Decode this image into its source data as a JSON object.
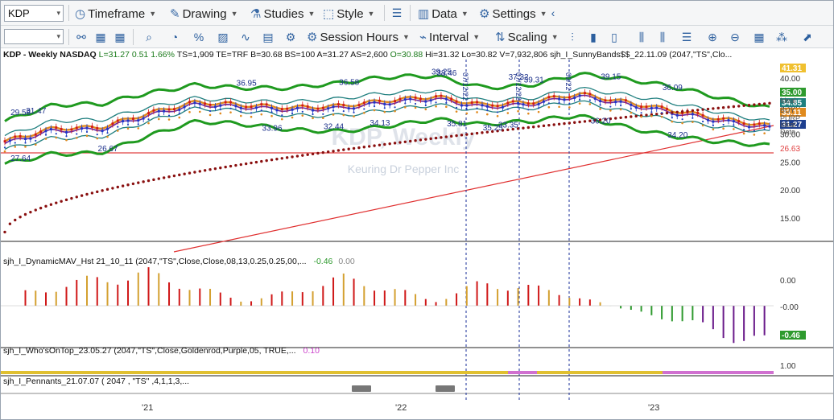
{
  "toolbar1": {
    "symbol": "KDP",
    "timeframe": "Timeframe",
    "drawing": "Drawing",
    "studies": "Studies",
    "style": "Style",
    "data": "Data",
    "settings": "Settings"
  },
  "toolbar2": {
    "session_hours": "Session Hours",
    "interval": "Interval",
    "scaling": "Scaling"
  },
  "header": {
    "title": "KDP - Weekly  NASDAQ",
    "L": "L=31.27",
    "chg": "0.51",
    "pct": "1.66%",
    "TS": "TS=1,909",
    "TE": "TE=TRF",
    "B": "B=30.68",
    "BS": "BS=100",
    "A": "A=31.27",
    "AS": "AS=2,600",
    "O": "O=30.88",
    "Hi": "Hi=31.32",
    "Lo": "Lo=30.82",
    "V": "V=7,932,806",
    "study": "sjh_I_SunnyBands$$_22.11.09 (2047,\"TS\",Clo..."
  },
  "watermark": {
    "line1": "KDP, Weekly",
    "line2": "Keuring Dr Pepper Inc"
  },
  "price_annotations": [
    "36.95",
    "36.58",
    "37.32",
    "39.25",
    "38.46",
    "39.31",
    "39.15",
    "36.09",
    "29.58",
    "31.47",
    "27.64",
    "26.67",
    "33.96",
    "32.44",
    "34.13",
    "35.81",
    "33.35",
    "36.20",
    "34.20",
    "35.25",
    "26.63"
  ],
  "right_axis": {
    "ticks": [
      "40.00",
      "35.00",
      "30.00",
      "25.00",
      "20.00",
      "15.00"
    ],
    "pills": [
      {
        "text": "41.31",
        "color": "#f0c030"
      },
      {
        "text": "35.00",
        "color": "#2e9a2e"
      },
      {
        "text": "34.85",
        "color": "#1f7f7f"
      },
      {
        "text": "33.11",
        "color": "#e08a1e"
      },
      {
        "text": "31.27",
        "color": "#1e3f8f"
      }
    ],
    "legend_labels": [
      "Ideal",
      "BUY",
      "PURP",
      "Ideal",
      "Date"
    ],
    "hline_label": "26.63"
  },
  "panel1": {
    "title": "sjh_I_DynamicMAV_Hst 21_10_11 (2047,\"TS\",Close,Close,08,13,0.25,0.25,00,...",
    "v1": "-0.46",
    "v2": "0.00",
    "ticks": [
      "0.00",
      "-0.00"
    ],
    "pill": "-0.46"
  },
  "panel2": {
    "title": "sjh_I_Who'sOnTop_23.05.27 (2047,\"TS\",Close,Goldenrod,Purple,05,  TRUE,...",
    "v1": "0.10"
  },
  "panel3": {
    "title": "sjh_I_Pennants_21.07.07 ( 2047 , \"TS\" ,4,1,1,3,...",
    "tick": "1.00"
  },
  "x_axis": {
    "labels": [
      "'21",
      "'22",
      "'23"
    ]
  },
  "vlines": [
    "07/12/22",
    "07/12/22",
    "09/22"
  ],
  "chart_data": {
    "type": "line",
    "title": "KDP - Weekly  NASDAQ",
    "x": [
      "2020-10",
      "2020-12",
      "2021-02",
      "2021-04",
      "2021-06",
      "2021-08",
      "2021-10",
      "2021-12",
      "2022-02",
      "2022-04",
      "2022-06",
      "2022-08",
      "2022-10",
      "2022-12",
      "2023-02",
      "2023-04",
      "2023-06"
    ],
    "series": [
      {
        "values": [
          28.5,
          30.8,
          31.0,
          33.5,
          35.5,
          35.0,
          34.5,
          34.8,
          35.8,
          36.5,
          35.0,
          35.5,
          37.0,
          35.5,
          34.0,
          32.5,
          31.27
        ]
      }
    ],
    "ylim": [
      10,
      42
    ],
    "hlines": [
      26.63
    ],
    "histogram": [
      0.1,
      0.2,
      0.3,
      0.35,
      0.2,
      0.05,
      0.15,
      0.3,
      0.2,
      0.05,
      0.25,
      0.2,
      0.1,
      -0.05,
      -0.15,
      -0.3,
      -0.46
    ]
  }
}
